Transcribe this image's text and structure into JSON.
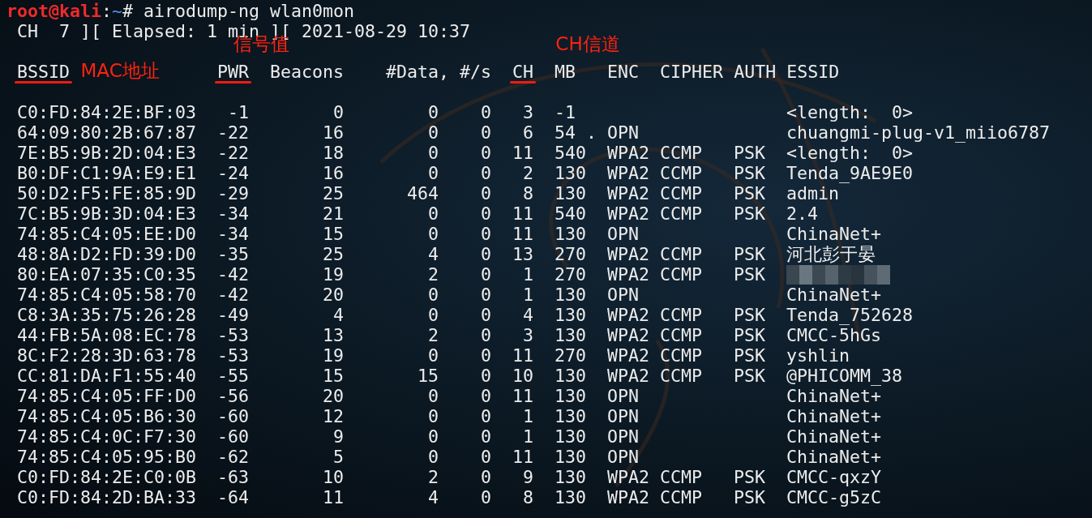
{
  "prompt": {
    "user_host": "root@kali",
    "separator": ":",
    "path": "~",
    "symbol": "#",
    "command": "airodump-ng wlan0mon"
  },
  "status_line": " CH  7 ][ Elapsed: 1 min ][ 2021-08-29 10:37",
  "columns": [
    {
      "label": "BSSID",
      "underlined": true,
      "annotation": {
        "text": "MAC地址",
        "kind": "beside"
      }
    },
    {
      "label": "PWR",
      "underlined": true,
      "annotation": {
        "text": "信号值",
        "kind": "above"
      }
    },
    {
      "label": "Beacons",
      "underlined": false
    },
    {
      "label": "#Data, #/s",
      "underlined": false
    },
    {
      "label": "CH",
      "underlined": true,
      "annotation": {
        "text": "CH信道",
        "kind": "above"
      }
    },
    {
      "label": "MB",
      "underlined": false
    },
    {
      "label": "ENC",
      "underlined": false
    },
    {
      "label": "CIPHER",
      "underlined": false
    },
    {
      "label": "AUTH",
      "underlined": false
    },
    {
      "label": "ESSID",
      "underlined": false
    }
  ],
  "rows": [
    {
      "bssid": "C0:FD:84:2E:BF:03",
      "pwr": "-1",
      "beacons": "0",
      "data": "0",
      "rate": "0",
      "ch": "3",
      "mb": "-1",
      "essid": "<length:  0>"
    },
    {
      "bssid": "64:09:80:2B:67:87",
      "pwr": "-22",
      "beacons": "16",
      "data": "0",
      "rate": "0",
      "ch": "6",
      "mb": "54 .",
      "enc": "OPN",
      "essid": "chuangmi-plug-v1_miio6787"
    },
    {
      "bssid": "7E:B5:9B:2D:04:E3",
      "pwr": "-22",
      "beacons": "18",
      "data": "0",
      "rate": "0",
      "ch": "11",
      "mb": "540",
      "enc": "WPA2",
      "cipher": "CCMP",
      "auth": "PSK",
      "essid": "<length:  0>"
    },
    {
      "bssid": "B0:DF:C1:9A:E9:E1",
      "pwr": "-24",
      "beacons": "16",
      "data": "0",
      "rate": "0",
      "ch": "2",
      "mb": "130",
      "enc": "WPA2",
      "cipher": "CCMP",
      "auth": "PSK",
      "essid": "Tenda_9AE9E0"
    },
    {
      "bssid": "50:D2:F5:FE:85:9D",
      "pwr": "-29",
      "beacons": "25",
      "data": "464",
      "rate": "0",
      "ch": "8",
      "mb": "130",
      "enc": "WPA2",
      "cipher": "CCMP",
      "auth": "PSK",
      "essid": "admin"
    },
    {
      "bssid": "7C:B5:9B:3D:04:E3",
      "pwr": "-34",
      "beacons": "21",
      "data": "0",
      "rate": "0",
      "ch": "11",
      "mb": "540",
      "enc": "WPA2",
      "cipher": "CCMP",
      "auth": "PSK",
      "essid": "2.4"
    },
    {
      "bssid": "74:85:C4:05:EE:D0",
      "pwr": "-34",
      "beacons": "15",
      "data": "0",
      "rate": "0",
      "ch": "11",
      "mb": "130",
      "enc": "OPN",
      "essid": "ChinaNet+"
    },
    {
      "bssid": "48:8A:D2:FD:39:D0",
      "pwr": "-35",
      "beacons": "25",
      "data": "4",
      "rate": "0",
      "ch": "13",
      "mb": "270",
      "enc": "WPA2",
      "cipher": "CCMP",
      "auth": "PSK",
      "essid": "河北彭于晏"
    },
    {
      "bssid": "80:EA:07:35:C0:35",
      "pwr": "-42",
      "beacons": "19",
      "data": "2",
      "rate": "0",
      "ch": "1",
      "mb": "270",
      "enc": "WPA2",
      "cipher": "CCMP",
      "auth": "PSK",
      "redacted": true
    },
    {
      "bssid": "74:85:C4:05:58:70",
      "pwr": "-42",
      "beacons": "20",
      "data": "0",
      "rate": "0",
      "ch": "1",
      "mb": "130",
      "enc": "OPN",
      "essid": "ChinaNet+"
    },
    {
      "bssid": "C8:3A:35:75:26:28",
      "pwr": "-49",
      "beacons": "4",
      "data": "0",
      "rate": "0",
      "ch": "4",
      "mb": "130",
      "enc": "WPA2",
      "cipher": "CCMP",
      "auth": "PSK",
      "essid": "Tenda_752628"
    },
    {
      "bssid": "44:FB:5A:08:EC:78",
      "pwr": "-53",
      "beacons": "13",
      "data": "2",
      "rate": "0",
      "ch": "3",
      "mb": "130",
      "enc": "WPA2",
      "cipher": "CCMP",
      "auth": "PSK",
      "essid": "CMCC-5hGs"
    },
    {
      "bssid": "8C:F2:28:3D:63:78",
      "pwr": "-53",
      "beacons": "19",
      "data": "0",
      "rate": "0",
      "ch": "11",
      "mb": "270",
      "enc": "WPA2",
      "cipher": "CCMP",
      "auth": "PSK",
      "essid": "yshlin"
    },
    {
      "bssid": "CC:81:DA:F1:55:40",
      "pwr": "-55",
      "beacons": "15",
      "data": "15",
      "rate": "0",
      "ch": "10",
      "mb": "130",
      "enc": "WPA2",
      "cipher": "CCMP",
      "auth": "PSK",
      "essid": "@PHICOMM_38"
    },
    {
      "bssid": "74:85:C4:05:FF:D0",
      "pwr": "-56",
      "beacons": "20",
      "data": "0",
      "rate": "0",
      "ch": "11",
      "mb": "130",
      "enc": "OPN",
      "essid": "ChinaNet+"
    },
    {
      "bssid": "74:85:C4:05:B6:30",
      "pwr": "-60",
      "beacons": "12",
      "data": "0",
      "rate": "0",
      "ch": "1",
      "mb": "130",
      "enc": "OPN",
      "essid": "ChinaNet+"
    },
    {
      "bssid": "74:85:C4:0C:F7:30",
      "pwr": "-60",
      "beacons": "9",
      "data": "0",
      "rate": "0",
      "ch": "1",
      "mb": "130",
      "enc": "OPN",
      "essid": "ChinaNet+"
    },
    {
      "bssid": "74:85:C4:05:95:B0",
      "pwr": "-62",
      "beacons": "5",
      "data": "0",
      "rate": "0",
      "ch": "11",
      "mb": "130",
      "enc": "OPN",
      "essid": "ChinaNet+"
    },
    {
      "bssid": "C0:FD:84:2E:C0:0B",
      "pwr": "-63",
      "beacons": "10",
      "data": "2",
      "rate": "0",
      "ch": "9",
      "mb": "130",
      "enc": "WPA2",
      "cipher": "CCMP",
      "auth": "PSK",
      "essid": "CMCC-qxzY"
    },
    {
      "bssid": "C0:FD:84:2D:BA:33",
      "pwr": "-64",
      "beacons": "11",
      "data": "4",
      "rate": "0",
      "ch": "8",
      "mb": "130",
      "enc": "WPA2",
      "cipher": "CCMP",
      "auth": "PSK",
      "essid": "CMCC-g5zC"
    }
  ]
}
